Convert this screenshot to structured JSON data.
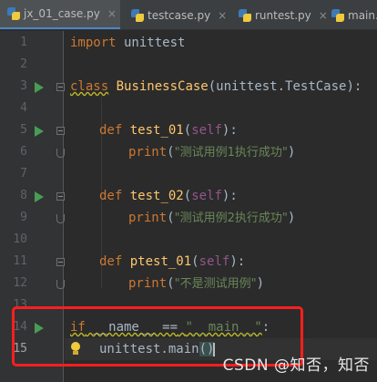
{
  "tabs": [
    {
      "title": "jx_01_case.py",
      "active": true,
      "close": "×"
    },
    {
      "title": "testcase.py",
      "active": false,
      "close": "×"
    },
    {
      "title": "runtest.py",
      "active": false,
      "close": "×"
    },
    {
      "title": "main.",
      "active": false,
      "close": ""
    }
  ],
  "gutter": {
    "line_numbers": [
      "1",
      "2",
      "3",
      "4",
      "5",
      "6",
      "7",
      "8",
      "9",
      "10",
      "11",
      "12",
      "13",
      "14",
      "15"
    ],
    "run_markers_on_lines": [
      3,
      5,
      8,
      14
    ]
  },
  "code": {
    "l1": {
      "kw": "import",
      "rest": " unittest"
    },
    "l3": {
      "kw": "class",
      "name": "BusinessCase",
      "rest": "(unittest.TestCase):"
    },
    "l5": {
      "kw": "def",
      "name": "test_01",
      "self": "self",
      "open": "(",
      "close": "):"
    },
    "l6": {
      "fn": "print",
      "open": "(",
      "str": "\"测试用例1执行成功\"",
      "close": ")"
    },
    "l8": {
      "kw": "def",
      "name": "test_02",
      "self": "self",
      "open": "(",
      "close": "):"
    },
    "l9": {
      "fn": "print",
      "open": "(",
      "str": "\"测试用例2执行成功\"",
      "close": ")"
    },
    "l11": {
      "kw": "def",
      "name": "ptest_01",
      "self": "self",
      "open": "(",
      "close": "):"
    },
    "l12": {
      "fn": "print",
      "open": "(",
      "str": "\"不是测试用例\"",
      "close": ")"
    },
    "l14": {
      "kw": "if",
      "name_var": " __name__ ",
      "op": "==",
      "space": " ",
      "str": "\"__main__\"",
      "colon": ":"
    },
    "l15": {
      "text": "unittest.main",
      "parens": "()"
    }
  },
  "watermark": "CSDN @知否，知否",
  "colors": {
    "keyword": "#cc7832",
    "function": "#ffc66d",
    "self": "#94558d",
    "string": "#6a8759",
    "annotation_box": "#ff1e1e"
  }
}
